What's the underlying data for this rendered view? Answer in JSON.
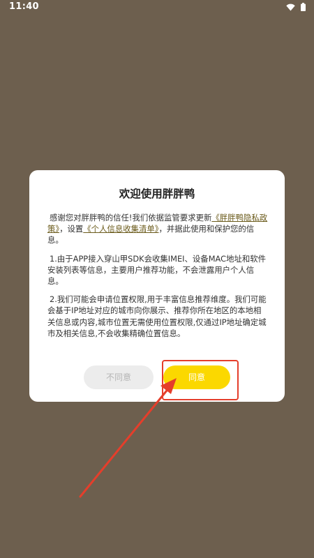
{
  "status_bar": {
    "time": "11:40",
    "icons": [
      "wifi-icon",
      "battery-icon"
    ]
  },
  "dialog": {
    "title": "欢迎使用胖胖鸭",
    "paragraph1": {
      "prefix": "感谢您对胖胖鸭的信任!我们依据监管要求更新",
      "privacy_link": "《胖胖鸭隐私政策》",
      "middle": "，设置",
      "info_link": "《个人信息收集清单》",
      "suffix": "，并据此使用和保护您的信息。"
    },
    "paragraph2": "1.由于APP接入穿山甲SDK会收集IMEI、设备MAC地址和软件安装列表等信息，主要用户推荐功能，不会泄露用户个人信息。",
    "paragraph3": "2.我们可能会申请位置权限,用于丰富信息推荐维度。我们可能会基于IP地址对应的城市向你展示、推荐你所在地区的本地相关信息或内容,城市位置无需使用位置权限,仅通过IP地址确定城市及相关信息,不会收集精确位置信息。",
    "disagree_label": "不同意",
    "agree_label": "同意"
  },
  "colors": {
    "overlay": "#6d5f4e",
    "agree_button": "#fbd800",
    "annotation": "#e53e2b"
  }
}
